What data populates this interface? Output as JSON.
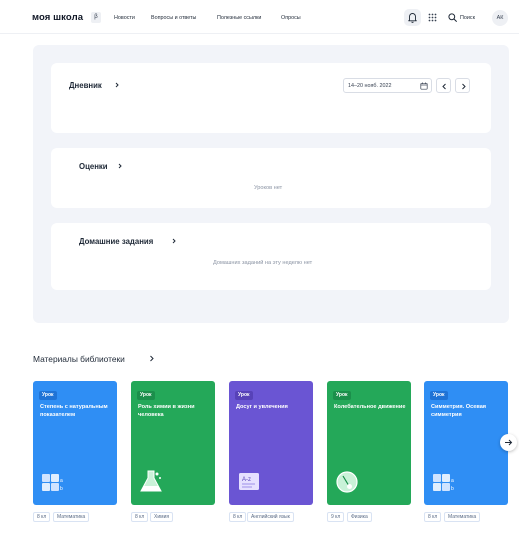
{
  "header": {
    "logo": "моя школа",
    "logo_badge": "β",
    "nav": [
      "Новости",
      "Вопросы и ответы",
      "Полезные ссылки",
      "Опросы"
    ],
    "search_label": "Поиск",
    "avatar_initials": "АК"
  },
  "diary": {
    "title": "Дневник",
    "date_range": "14–20 нояб. 2022"
  },
  "grades": {
    "title": "Оценки",
    "empty": "Уроков нет"
  },
  "homework": {
    "title": "Домашние задания",
    "empty": "Домашних заданий на эту неделю нет"
  },
  "library": {
    "title": "Материалы библиотеки",
    "items": [
      {
        "badge": "Урок",
        "title": "Степень с натуральным показателем",
        "tags": [
          "8 кл",
          "Математика"
        ],
        "color": "#2f8ef4",
        "badge_color": "#1f73d6",
        "icon": "math-blocks-icon"
      },
      {
        "badge": "Урок",
        "title": "Роль химии в жизни человека",
        "tags": [
          "8 кл",
          "Химия"
        ],
        "color": "#24a859",
        "badge_color": "#1b8f4b",
        "icon": "chemistry-flask-icon"
      },
      {
        "badge": "Урок",
        "title": "Досуг и увлечения",
        "tags": [
          "8 кл",
          "Английский язык"
        ],
        "color": "#6a55d3",
        "badge_color": "#5742b8",
        "icon": "language-book-icon"
      },
      {
        "badge": "Урок",
        "title": "Колебательное движение",
        "tags": [
          "9 кл",
          "Физика"
        ],
        "color": "#24a859",
        "badge_color": "#1b8f4b",
        "icon": "physics-pendulum-icon"
      },
      {
        "badge": "Урок",
        "title": "Симметрия. Осевая симметрия",
        "tags": [
          "8 кл",
          "Математика"
        ],
        "color": "#2f8ef4",
        "badge_color": "#1f73d6",
        "icon": "math-blocks-icon"
      }
    ]
  }
}
